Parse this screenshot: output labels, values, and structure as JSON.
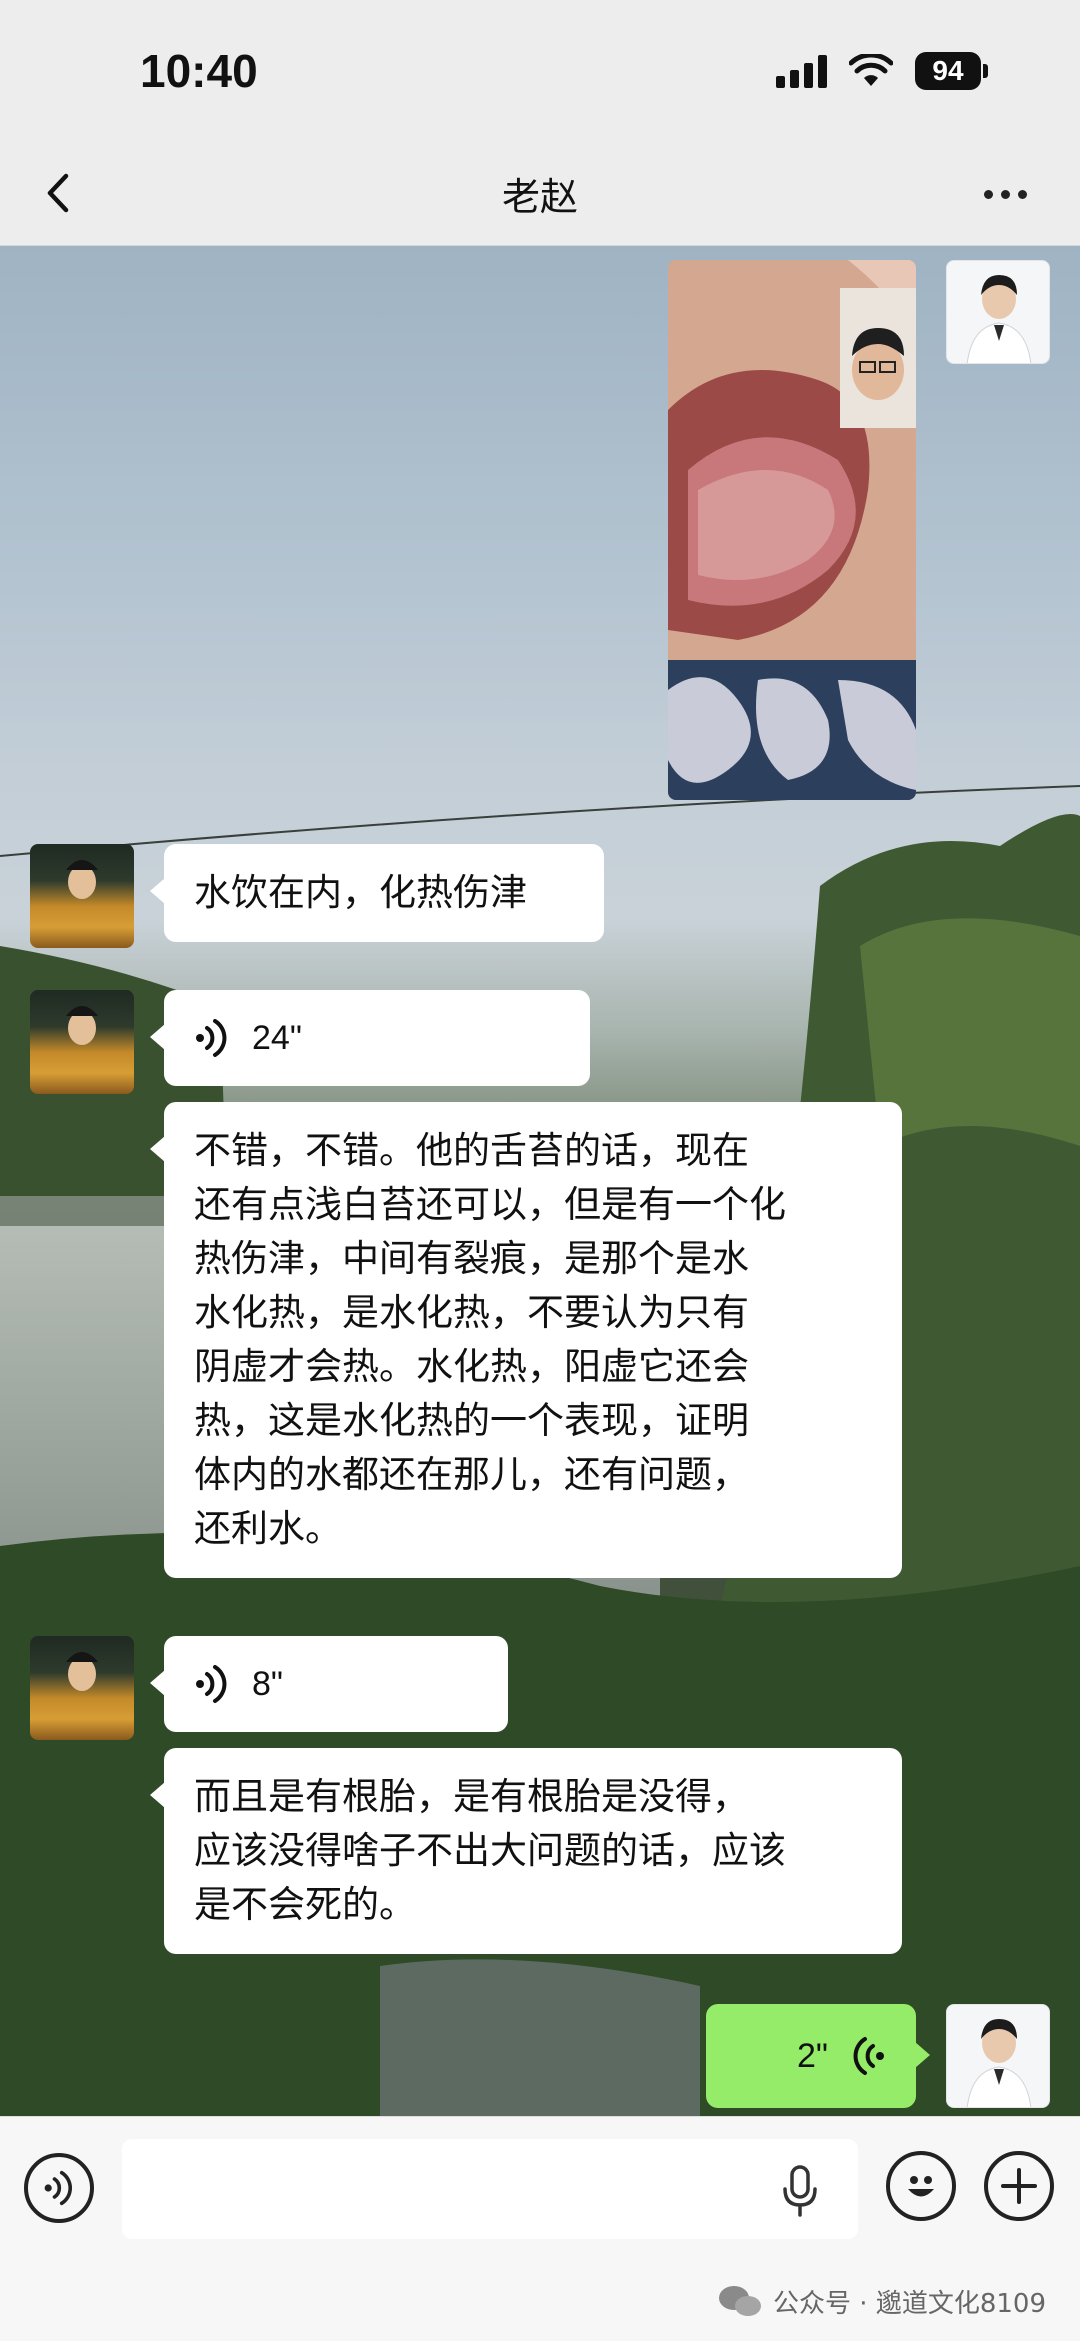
{
  "status": {
    "time": "10:40",
    "battery": "94"
  },
  "nav": {
    "title": "老赵"
  },
  "messages": [
    {
      "type": "image",
      "side": "right"
    },
    {
      "type": "text",
      "side": "left",
      "text": "水饮在内，化热伤津"
    },
    {
      "type": "voice",
      "side": "left",
      "duration": "24\""
    },
    {
      "type": "text",
      "side": "left",
      "lines": [
        "不错，不错。他的舌苔的话，现在",
        "还有点浅白苔还可以，但是有一个化",
        "热伤津，中间有裂痕，是那个是水",
        "水化热，是水化热，不要认为只有",
        "阴虚才会热。水化热，阳虚它还会",
        "热，这是水化热的一个表现，证明",
        "体内的水都还在那儿，还有问题，",
        "还利水。"
      ]
    },
    {
      "type": "voice",
      "side": "left",
      "duration": "8\""
    },
    {
      "type": "text",
      "side": "left",
      "lines": [
        "而且是有根胎，是有根胎是没得，",
        "应该没得啥子不出大问题的话，应该",
        "是不会死的。"
      ]
    },
    {
      "type": "voice",
      "side": "right",
      "duration": "2\""
    }
  ],
  "input": {
    "placeholder": ""
  },
  "watermark": {
    "text": "公众号 · 邈道文化8109"
  },
  "colors": {
    "bubble_left": "#ffffff",
    "bubble_right": "#95ec69",
    "bar": "#ededed"
  }
}
